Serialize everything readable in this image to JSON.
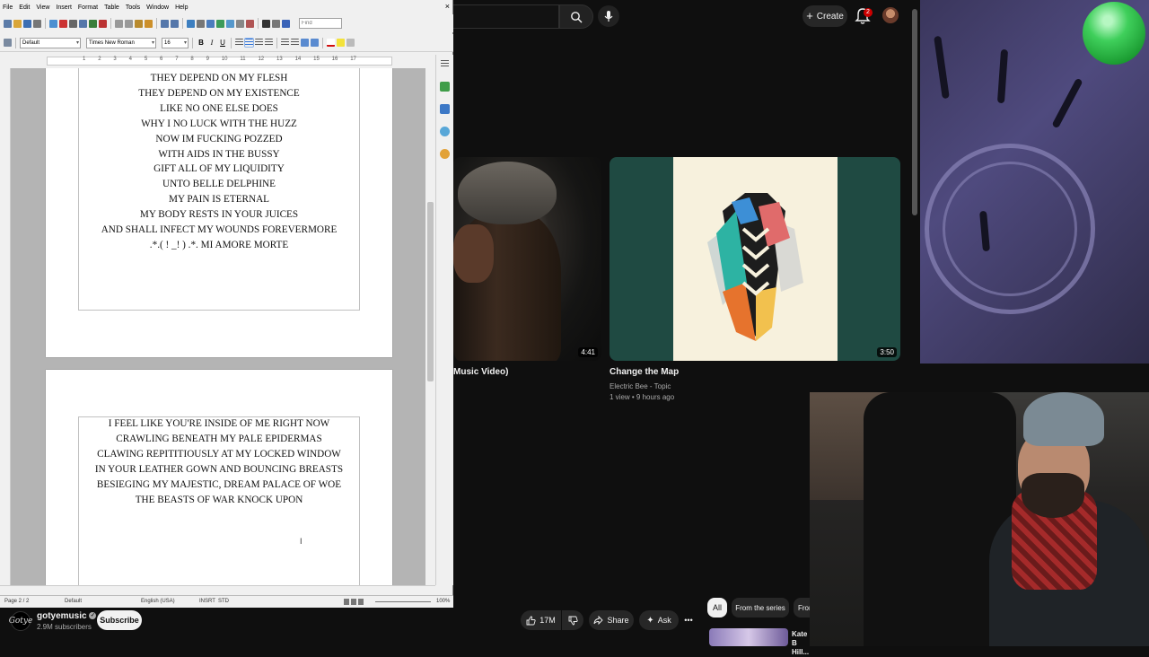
{
  "writer": {
    "menu": [
      "File",
      "Edit",
      "View",
      "Insert",
      "Format",
      "Table",
      "Tools",
      "Window",
      "Help"
    ],
    "close_glyph": "×",
    "find_placeholder": "Find",
    "paragraph_style": "Default",
    "font_name": "Times New Roman",
    "font_size": "16",
    "format_buttons": {
      "bold": "B",
      "italic": "I",
      "underline": "U"
    },
    "ruler_numbers": [
      "1",
      "2",
      "3",
      "4",
      "5",
      "6",
      "7",
      "8",
      "9",
      "10",
      "11",
      "12",
      "13",
      "14",
      "15",
      "16",
      "17"
    ],
    "page1_lines": [
      "THEY DEPEND ON MY FLESH",
      "THEY DEPEND ON MY EXISTENCE",
      "LIKE NO ONE ELSE DOES",
      "WHY I NO LUCK WITH THE HUZZ",
      "NOW IM FUCKING POZZED",
      "WITH AIDS IN THE BUSSY",
      "GIFT ALL OF MY LIQUIDITY",
      "UNTO BELLE DELPHINE",
      "MY PAIN IS ETERNAL",
      "MY BODY RESTS IN YOUR JUICES",
      "AND SHALL INFECT MY WOUNDS FOREVERMORE",
      ".*.( ! _! ) .*. MI AMORE MORTE"
    ],
    "page2_lines": [
      "I FEEL LIKE YOU'RE INSIDE OF ME RIGHT NOW",
      "CRAWLING BENEATH MY PALE EPIDERMAS",
      "CLAWING REPITITIOUSLY AT MY LOCKED WINDOW",
      "IN YOUR LEATHER GOWN AND BOUNCING BREASTS",
      "BESIEGING MY MAJESTIC, DREAM PALACE OF WOE",
      "THE BEASTS OF WAR KNOCK UPON"
    ],
    "status": {
      "page": "Page 2 / 2",
      "style": "Default",
      "language": "English (USA)",
      "mode": "INSRT",
      "selection": "STD",
      "zoom": "100%"
    }
  },
  "youtube": {
    "create_label": "Create",
    "notification_count": "2",
    "video1": {
      "title": "Music Video)",
      "duration": "4:41"
    },
    "video2": {
      "title": "Change the Map",
      "channel": "Electric Bee - Topic",
      "meta": "1 view • 9 hours ago",
      "duration": "3:50"
    },
    "channel": {
      "logo_text": "Gotye",
      "name": "gotyemusic",
      "subscribers": "2.9M subscribers",
      "subscribe_label": "Subscribe"
    },
    "actions": {
      "likes": "17M",
      "share": "Share",
      "ask": "Ask",
      "more": "•••"
    },
    "chips": [
      "All",
      "From the series",
      "From"
    ],
    "related_title": "Kate B Hill..."
  },
  "colors": {
    "yt_bg": "#0f0f0f",
    "brand_red": "#cc0000",
    "writer_chrome": "#f0f0f0"
  }
}
